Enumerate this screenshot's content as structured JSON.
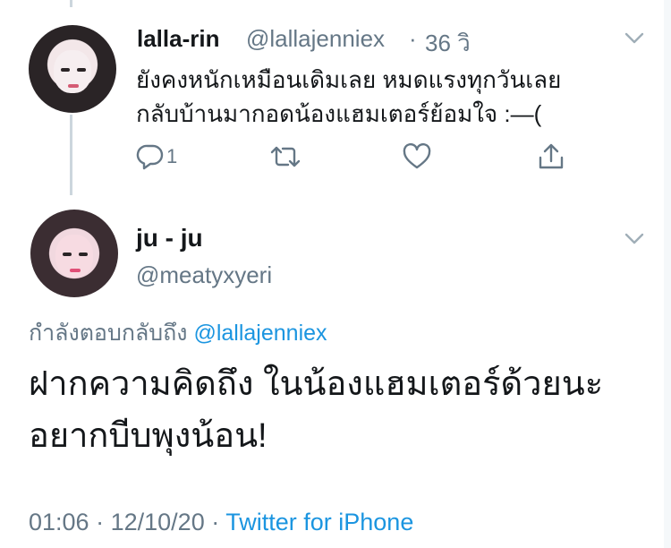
{
  "tweet1": {
    "display_name": "lalla-rin",
    "handle": "@lallajenniex",
    "separator": "·",
    "time": "36 วิ",
    "line1": "ยังคงหนักเหมือนเดิมเลย หมดแรงทุกวันเลย",
    "line2": "กลับบ้านมากอดน้องแฮมเตอร์ย้อมใจ :—(",
    "reply_count": "1",
    "icons": [
      "reply-icon",
      "retweet-icon",
      "like-icon",
      "share-icon",
      "chevron-down-icon"
    ]
  },
  "tweet2": {
    "display_name": "ju - ju",
    "handle": "@meatyxyeri",
    "replying_label": "กำลังตอบกลับถึง",
    "replying_to": "@lallajenniex",
    "line1": "ฝากความคิดถึง ในน้องแฮมเตอร์ด้วยนะ",
    "line2": "อยากบีบพุงน้อน!",
    "time": "01:06",
    "separator": "·",
    "date": "12/10/20",
    "separator2": "·",
    "source": "Twitter for iPhone"
  },
  "colors": {
    "text": "#14171a",
    "secondary": "#657786",
    "link": "#1b95e0",
    "thread_line": "#ccd6dd"
  }
}
